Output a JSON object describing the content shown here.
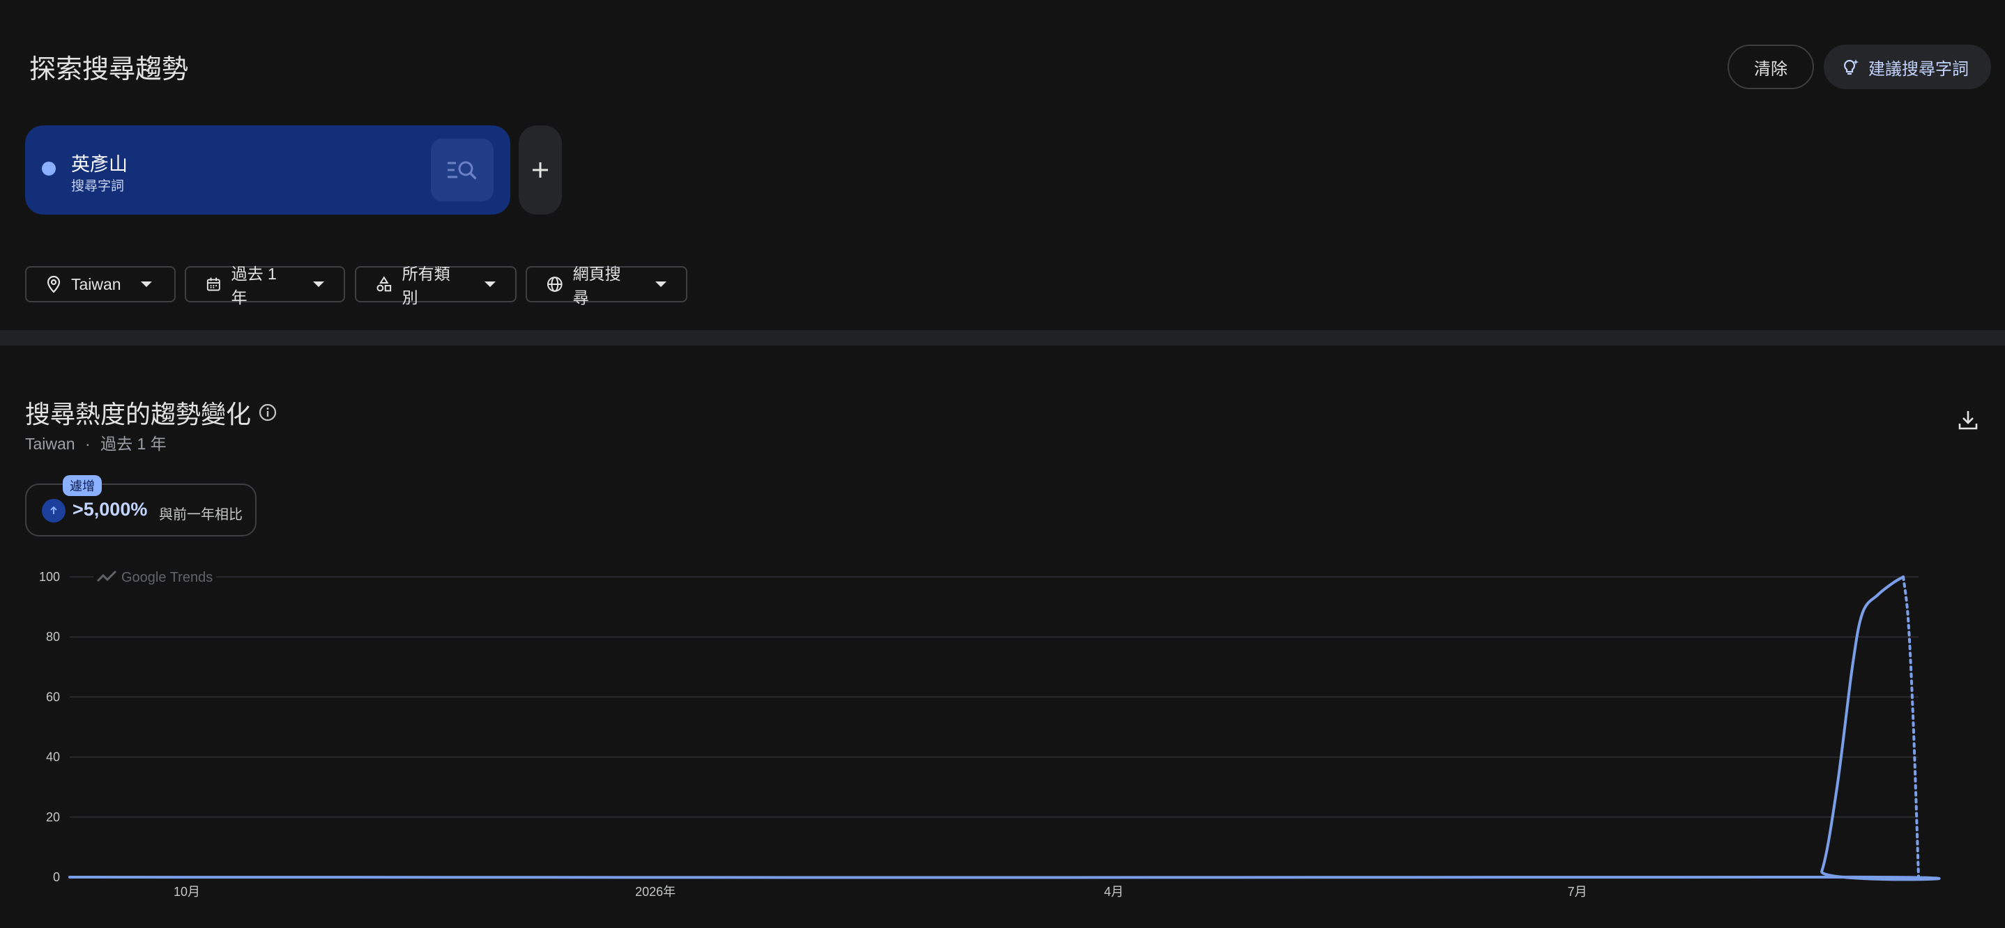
{
  "header": {
    "title": "探索搜尋趨勢",
    "clear_label": "清除",
    "suggest_label": "建議搜尋字詞"
  },
  "term": {
    "name": "英彥山",
    "type": "搜尋字詞",
    "color": "#8ab0ff"
  },
  "filters": {
    "location": "Taiwan",
    "time": "過去 1 年",
    "category": "所有類別",
    "property": "網頁搜尋"
  },
  "section": {
    "title": "搜尋熱度的趨勢變化",
    "subtitle_location": "Taiwan",
    "subtitle_sep": "·",
    "subtitle_time": "過去 1 年"
  },
  "stat": {
    "badge": "遽增",
    "value": ">5,000%",
    "caption": "與前一年相比"
  },
  "chart_data": {
    "type": "line",
    "watermark": "Google Trends",
    "ylim": [
      0,
      100
    ],
    "yticks": [
      0,
      20,
      40,
      60,
      80,
      100
    ],
    "xlim": [
      "2025-09-08",
      "2026-09-06"
    ],
    "xticks": [
      {
        "label": "10月",
        "date": "2025-10-01"
      },
      {
        "label": "2026年",
        "date": "2026-01-01"
      },
      {
        "label": "4月",
        "date": "2026-04-01"
      },
      {
        "label": "7月",
        "date": "2026-07-01"
      }
    ],
    "grid": true,
    "line_color": "#7b9ee8",
    "series": [
      {
        "solid": [
          {
            "date": "2025-09-08",
            "value": 0
          },
          {
            "date": "2026-08-15",
            "value": 0
          },
          {
            "date": "2026-08-18",
            "value": 2
          },
          {
            "date": "2026-08-21",
            "value": 30
          },
          {
            "date": "2026-08-24",
            "value": 70
          },
          {
            "date": "2026-08-26",
            "value": 88
          },
          {
            "date": "2026-08-29",
            "value": 94
          },
          {
            "date": "2026-09-01",
            "value": 98
          },
          {
            "date": "2026-09-03",
            "value": 100
          }
        ],
        "partial": [
          {
            "date": "2026-09-03",
            "value": 100
          },
          {
            "date": "2026-09-04",
            "value": 85
          },
          {
            "date": "2026-09-05",
            "value": 50
          },
          {
            "date": "2026-09-06",
            "value": 0
          }
        ]
      }
    ]
  }
}
